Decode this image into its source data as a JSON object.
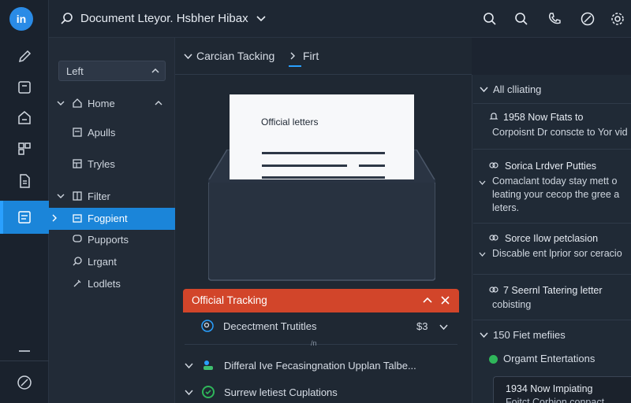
{
  "app": {
    "logo_text": "in",
    "window_title": "Document Lteyor. Hsbher Hibax"
  },
  "icons": {
    "top": [
      "search-icon",
      "search-icon-2",
      "phone-icon",
      "compass-icon",
      "gear-icon"
    ],
    "rail": [
      "pen-icon",
      "note-icon",
      "tag-icon",
      "grid-icon",
      "document-icon",
      "inbox-icon",
      "minus-icon",
      "compass-icon"
    ]
  },
  "colors": {
    "accent": "#1b85d9",
    "banner": "#d2452a",
    "success": "#2fb65a"
  },
  "nav": {
    "select_label": "Left",
    "items": [
      {
        "label": "Home"
      },
      {
        "label": "Apulls"
      },
      {
        "label": "Tryles"
      },
      {
        "label": "Filter"
      },
      {
        "label": "Fogpient"
      },
      {
        "label": "Pupports"
      },
      {
        "label": "Lrgant"
      },
      {
        "label": "Lodlets"
      }
    ]
  },
  "breadcrumb": {
    "first": "Carcian Tacking",
    "second": "Firt"
  },
  "illustration": {
    "paper_title": "Official letters"
  },
  "tracking": {
    "banner_title": "Official Tracking",
    "rows": [
      {
        "label": "Decectment Trutitles",
        "count": "$3"
      },
      {
        "label": "Differal Ive Fecasingnation Upplan Talbe..."
      },
      {
        "label": "Surrew letiest Cuplations"
      }
    ],
    "divider_mark": "/n"
  },
  "right_panel": {
    "header": "All clliating",
    "items": [
      {
        "title": "1958 Now Ftats to",
        "body": [
          "Corpoisnt Dr conscte to Yor vid"
        ]
      },
      {
        "title": "Sorica Lrdver Putties",
        "body": [
          "Comaclant today stay mett o",
          "leating your cecop the gree a",
          "leters."
        ]
      },
      {
        "title": "Sorce Ilow petclasion",
        "body": [
          "Discable ent lprior sor ceracio"
        ]
      },
      {
        "title": "7 Seernl Tatering letter",
        "body": [
          "cobisting"
        ]
      }
    ],
    "section2_header": "150 Fiet mefiies",
    "status_label": "Orgamt Entertations",
    "card_title": "1934 Now Impiating",
    "card_sub": "Foitct Corbion conpact"
  }
}
